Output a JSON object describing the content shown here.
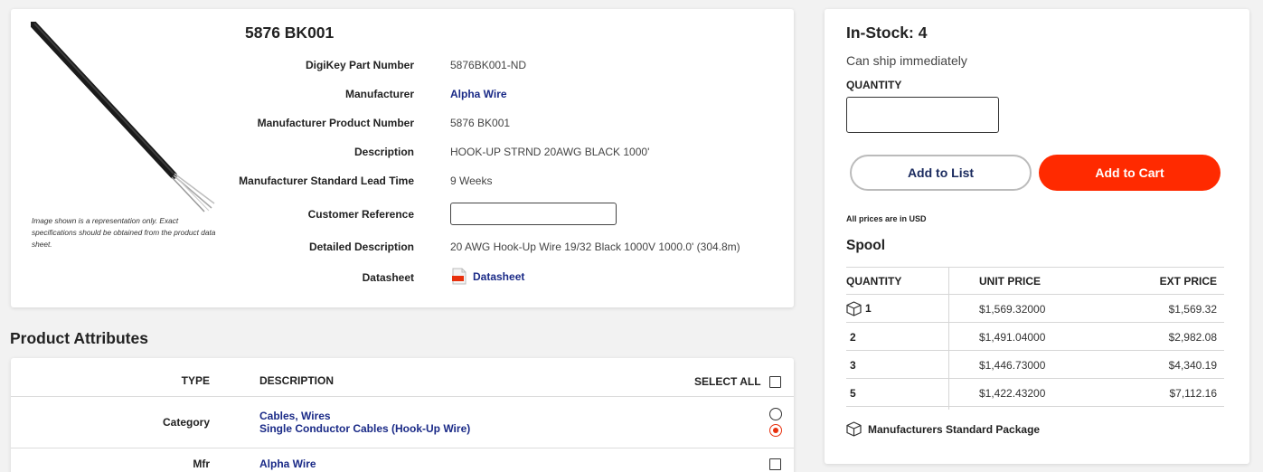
{
  "product": {
    "title": "5876 BK001",
    "image_note": "Image shown is a representation only. Exact specifications should be obtained from the product data sheet.",
    "details": [
      {
        "label": "DigiKey Part Number",
        "value": "5876BK001-ND"
      },
      {
        "label": "Manufacturer",
        "value": "Alpha Wire"
      },
      {
        "label": "Manufacturer Product Number",
        "value": "5876 BK001"
      },
      {
        "label": "Description",
        "value": "HOOK-UP STRND 20AWG BLACK 1000'"
      },
      {
        "label": "Manufacturer Standard Lead Time",
        "value": "9 Weeks"
      },
      {
        "label": "Customer Reference",
        "value": ""
      },
      {
        "label": "Detailed Description",
        "value": "20 AWG Hook-Up Wire 19/32 Black 1000V 1000.0' (304.8m)"
      },
      {
        "label": "Datasheet",
        "value": "Datasheet"
      }
    ]
  },
  "attributes": {
    "section_title": "Product Attributes",
    "header_type": "TYPE",
    "header_description": "DESCRIPTION",
    "header_select_all": "SELECT ALL",
    "rows": [
      {
        "type": "Category",
        "desc_line1": "Cables, Wires",
        "desc_line2": "Single Conductor Cables (Hook-Up Wire)"
      },
      {
        "type": "Mfr",
        "desc_line1": "Alpha Wire"
      }
    ]
  },
  "stock": {
    "title": "In-Stock: 4",
    "ship_text": "Can ship immediately",
    "quantity_label": "QUANTITY",
    "quantity_value": "",
    "add_to_list": "Add to List",
    "add_to_cart": "Add to Cart",
    "prices_note": "All prices are in USD",
    "package_title": "Spool",
    "table_headers": {
      "qty": "QUANTITY",
      "unit": "UNIT PRICE",
      "ext": "EXT PRICE"
    },
    "price_rows": [
      {
        "qty": "1",
        "unit": "$1,569.32000",
        "ext": "$1,569.32"
      },
      {
        "qty": "2",
        "unit": "$1,491.04000",
        "ext": "$2,982.08"
      },
      {
        "qty": "3",
        "unit": "$1,446.73000",
        "ext": "$4,340.19"
      },
      {
        "qty": "5",
        "unit": "$1,422.43200",
        "ext": "$7,112.16"
      }
    ],
    "std_package": "Manufacturers Standard Package"
  },
  "colors": {
    "accent": "#ff2a00",
    "link": "#1a2a87",
    "background": "#f2f2f2"
  }
}
